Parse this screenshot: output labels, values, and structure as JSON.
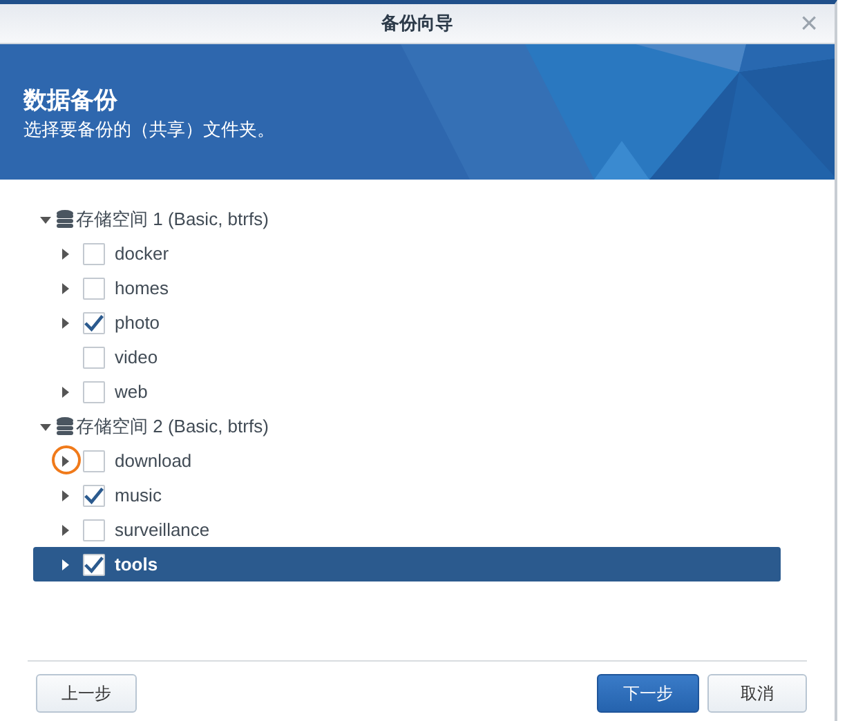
{
  "window": {
    "title": "备份向导",
    "close": "×"
  },
  "banner": {
    "title": "数据备份",
    "subtitle": "选择要备份的（共享）文件夹。"
  },
  "tree": [
    {
      "label": "存储空间 1 (Basic, btrfs)",
      "expanded": true,
      "children": [
        {
          "label": "docker",
          "expandable": true,
          "checked": false,
          "selected": false
        },
        {
          "label": "homes",
          "expandable": true,
          "checked": false,
          "selected": false
        },
        {
          "label": "photo",
          "expandable": true,
          "checked": true,
          "selected": false
        },
        {
          "label": "video",
          "expandable": false,
          "checked": false,
          "selected": false
        },
        {
          "label": "web",
          "expandable": true,
          "checked": false,
          "selected": false
        }
      ]
    },
    {
      "label": "存储空间 2 (Basic, btrfs)",
      "expanded": true,
      "children": [
        {
          "label": "download",
          "expandable": true,
          "checked": false,
          "selected": false,
          "circled": true
        },
        {
          "label": "music",
          "expandable": true,
          "checked": true,
          "selected": false
        },
        {
          "label": "surveillance",
          "expandable": true,
          "checked": false,
          "selected": false
        },
        {
          "label": "tools",
          "expandable": true,
          "checked": true,
          "selected": true
        }
      ]
    }
  ],
  "buttons": [
    {
      "label": "上一步",
      "kind": "secondary"
    },
    {
      "label": "下一步",
      "kind": "primary"
    },
    {
      "label": "取消",
      "kind": "secondary"
    }
  ]
}
